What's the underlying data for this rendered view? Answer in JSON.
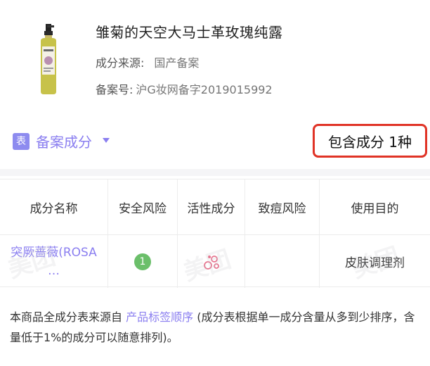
{
  "product": {
    "title": "雏菊的天空大马士革玫瑰纯露",
    "source_label": "成分来源:",
    "source_value": "国产备案",
    "reg_label": "备案号:",
    "reg_value": "沪G妆网备字2019015992",
    "image_icon": "spray-bottle-image"
  },
  "section": {
    "tag": "表",
    "title": "备案成分",
    "count": "包含成分 1种",
    "accent": "#8b7ff0",
    "highlight_color": "#e03326"
  },
  "table": {
    "headers": [
      "成分名称",
      "安全风险",
      "活性成分",
      "致痘风险",
      "使用目的"
    ],
    "rows": [
      {
        "name_line1": "突厥蔷薇(ROSA",
        "name_line2": "…",
        "safety": "1",
        "active_icon": "active-ingredient-icon",
        "acne": "",
        "purpose": "皮肤调理剂"
      }
    ]
  },
  "watermark": "美团",
  "note": {
    "prefix": "本商品全成分表来源自 ",
    "link": "产品标签顺序",
    "suffix": " (成分表根据单一成分含量从多到少排序，含量低于1%的成分可以随意排列)。"
  }
}
